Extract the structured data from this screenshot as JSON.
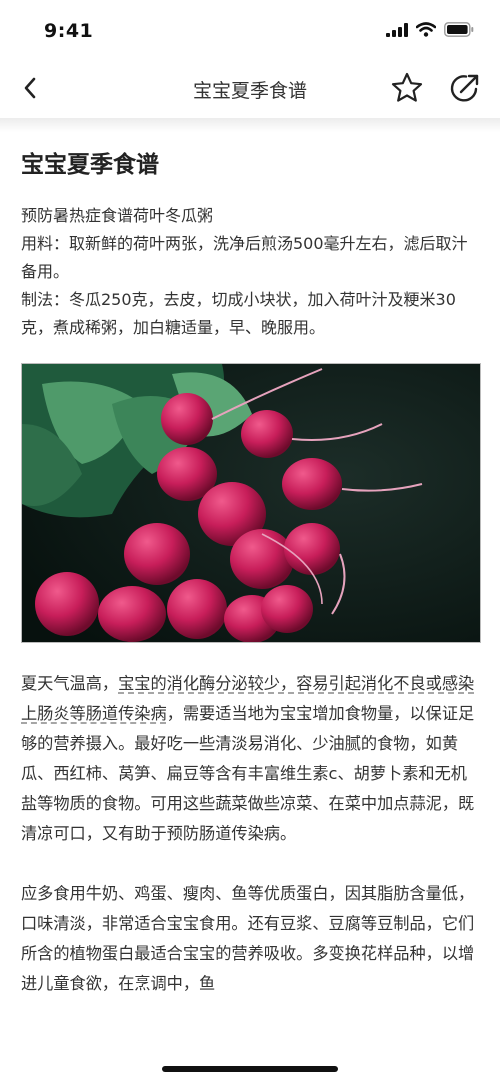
{
  "status_bar": {
    "time": "9:41"
  },
  "nav": {
    "title": "宝宝夏季食谱"
  },
  "article": {
    "title": "宝宝夏季食谱",
    "intro": [
      "预防暑热症食谱荷叶冬瓜粥",
      "用料：取新鲜的荷叶两张，洗净后煎汤500毫升左右，滤后取汁备用。",
      "制法：冬瓜250克，去皮，切成小块状，加入荷叶汁及粳米30克，煮成稀粥，加白糖适量，早、晚服用。"
    ],
    "para1": {
      "lead": "夏天气温高，",
      "underlined": "宝宝的消化酶分泌较少，容易引起消化不良或感染上肠炎等肠道传染病",
      "rest": "，需要适当地为宝宝增加食物量，以保证足够的营养摄入。最好吃一些清淡易消化、少油腻的食物，如黄瓜、西红柿、莴笋、扁豆等含有丰富维生素c、胡萝卜素和无机盐等物质的食物。可用这些蔬菜做些凉菜、在菜中加点蒜泥，既清凉可口，又有助于预防肠道传染病。"
    },
    "para2": "应多食用牛奶、鸡蛋、瘦肉、鱼等优质蛋白，因其脂肪含量低，口味清淡，非常适合宝宝食用。还有豆浆、豆腐等豆制品，它们所含的植物蛋白最适合宝宝的营养吸收。多变换花样品种，以增进儿童食欲，在烹调中，鱼"
  },
  "icons": {
    "back": "chevron-left-icon",
    "favorite": "star-outline-icon",
    "share": "share-arrow-icon",
    "signal": "signal-bars-icon",
    "wifi": "wifi-icon",
    "battery": "battery-icon"
  }
}
